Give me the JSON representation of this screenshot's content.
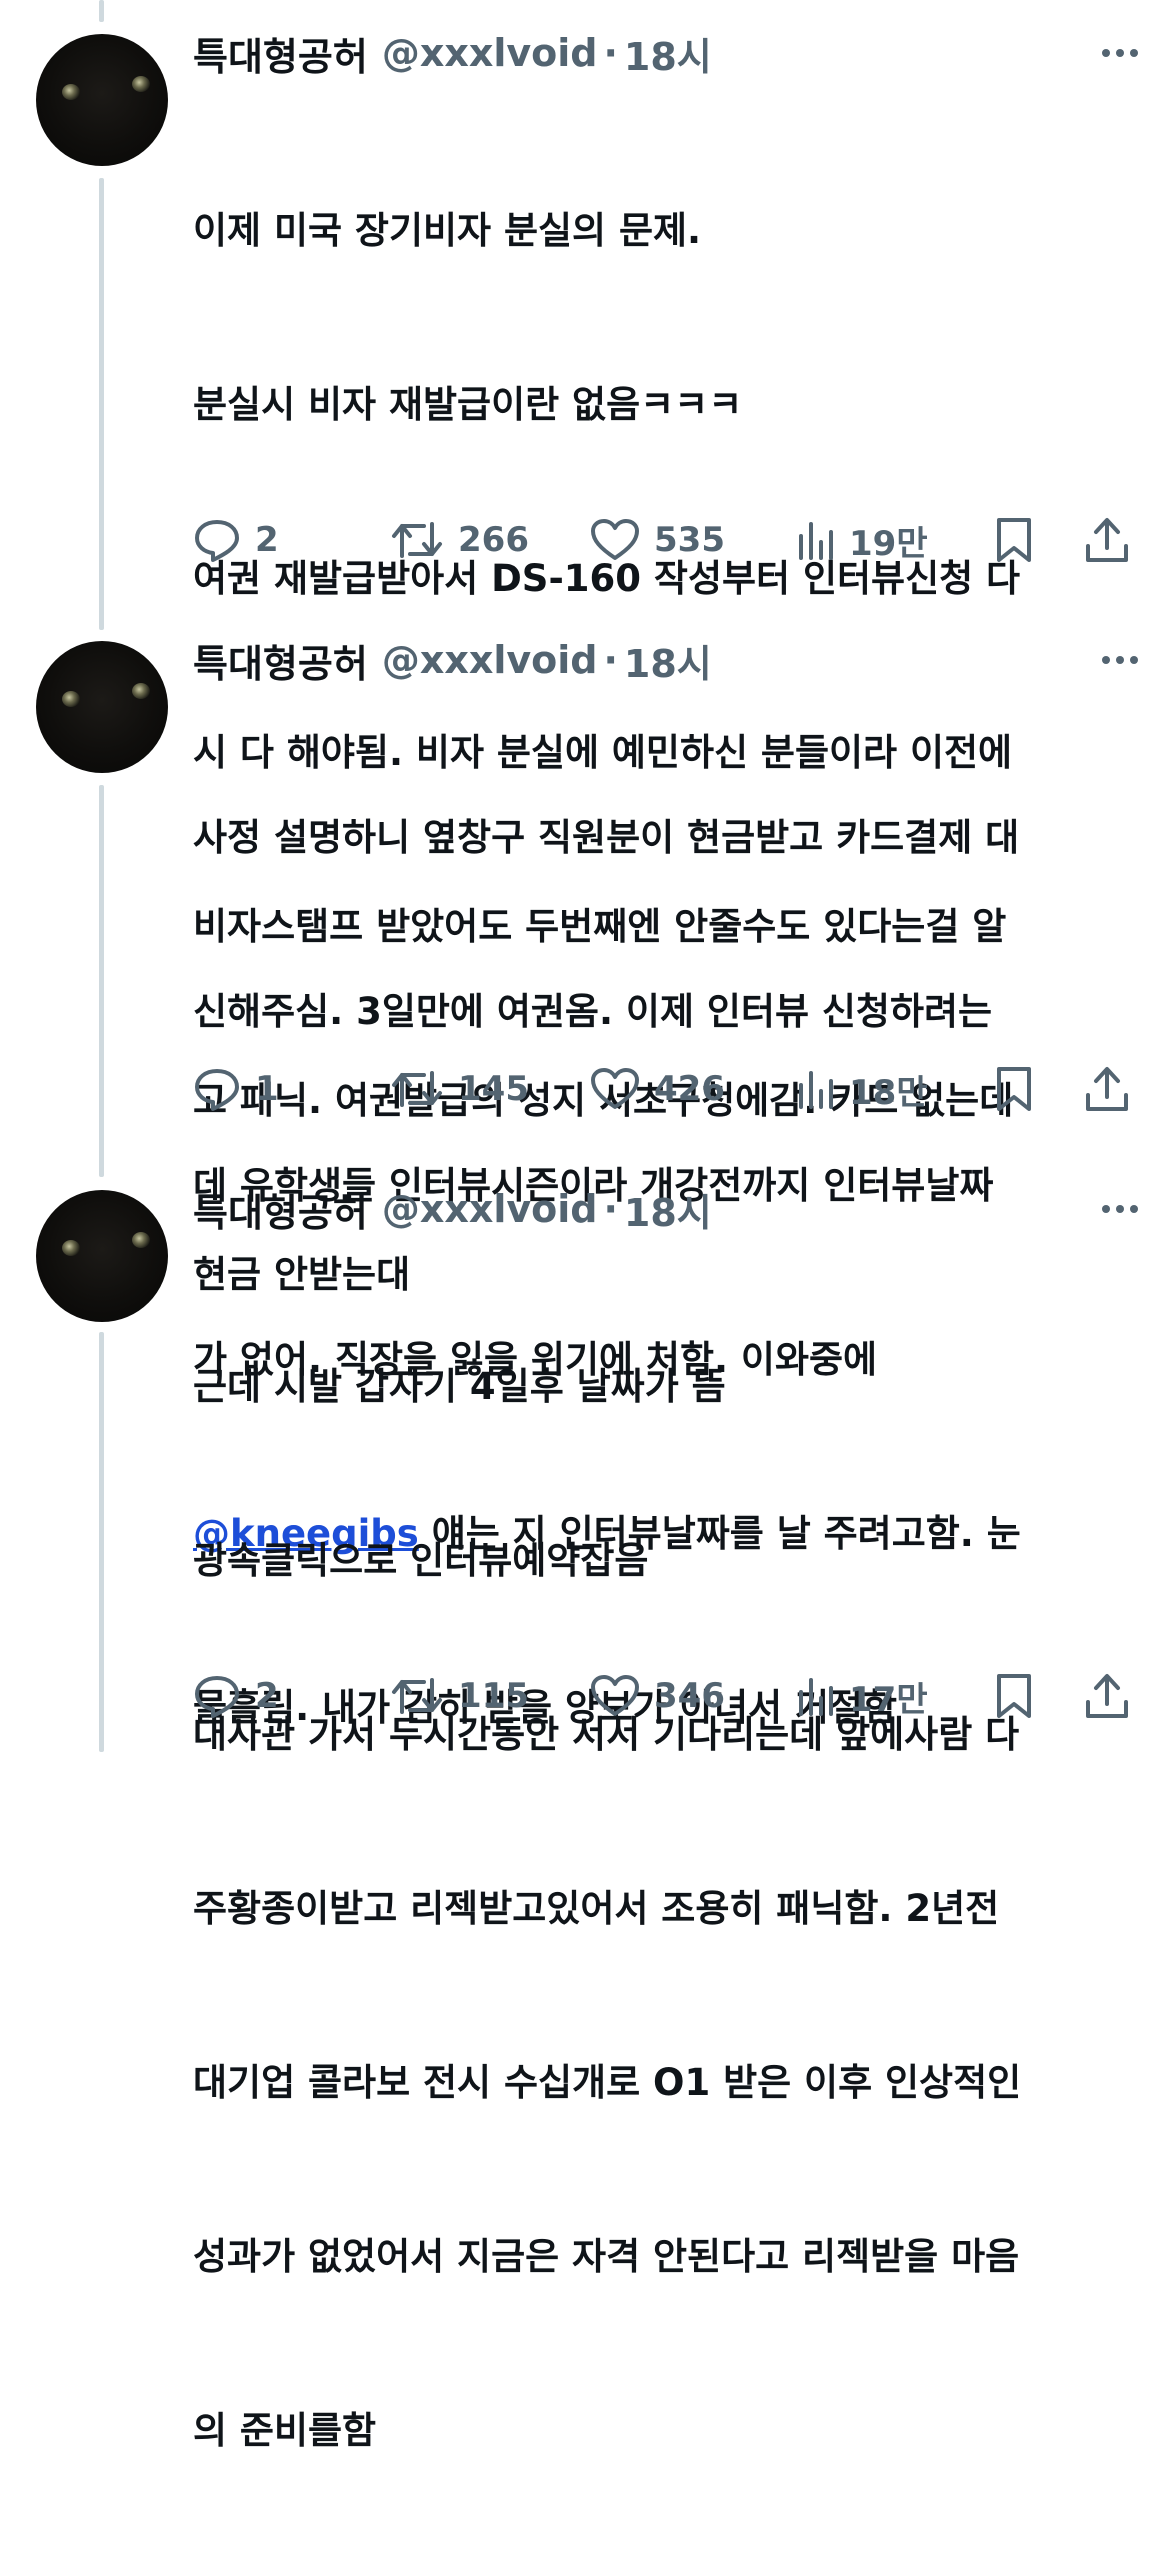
{
  "tweets": [
    {
      "display_name": "특대형공허",
      "handle": "@xxxlvoid",
      "separator": "·",
      "time": "18시",
      "lines": [
        "이제 미국 장기비자 분실의 문제.",
        "분실시 비자 재발급이란 없음ㅋㅋㅋ",
        "여권 재발급받아서 DS-160 작성부터 인터뷰신청 다",
        "시 다 해야됨. 비자 분실에 예민하신 분들이라 이전에",
        "비자스탬프 받았어도 두번째엔 안줄수도 있다는걸 알",
        "고 패닉. 여권발급의 성지 서초구청에감. 카드 없는데",
        "현금 안받는대"
      ],
      "mention": "",
      "replies": "2",
      "retweets": "266",
      "likes": "535",
      "views": "19만"
    },
    {
      "display_name": "특대형공허",
      "handle": "@xxxlvoid",
      "separator": "·",
      "time": "18시",
      "lines_before_mention": [
        "사정 설명하니 옆창구 직원분이 현금받고 카드결제 대",
        "신해주심. 3일만에 여권옴. 이제 인터뷰 신청하려는",
        "데 유학생들 인터뷰시즌이라 개강전까지 인터뷰날짜",
        "가 없어. 직장을 잃을 위기에 처함. 이와중에"
      ],
      "mention": "@kneegibs",
      "mention_suffix": " 얘는 지 인터뷰날짜를 날 주려고함. 눈",
      "lines_after_mention": [
        "물흘림. 내가 감히 받을 양보가 아녀서 거절함"
      ],
      "replies": "1",
      "retweets": "145",
      "likes": "426",
      "views": "18만"
    },
    {
      "display_name": "특대형공허",
      "handle": "@xxxlvoid",
      "separator": "·",
      "time": "18시",
      "lines": [
        "근데 시발 갑자기 4일후 날짜가 뜸",
        "광속클릭으로 인터뷰예약잡음",
        "대사관 가서 두시간동안 서서 기다리는데 앞에사람 다",
        "주황종이받고 리젝받고있어서 조용히 패닉함. 2년전",
        "대기업 콜라보 전시 수십개로 O1 받은 이후 인상적인",
        "성과가 없었어서 지금은 자격 안된다고 리젝받을 마음",
        "의 준비를함"
      ],
      "mention": "",
      "replies": "2",
      "retweets": "115",
      "likes": "346",
      "views": "17만"
    }
  ],
  "icons": {
    "reply": "reply-icon",
    "retweet": "retweet-icon",
    "like": "heart-icon",
    "views": "views-icon",
    "bookmark": "bookmark-icon",
    "share": "share-icon",
    "more": "more-icon"
  },
  "colors": {
    "text": "#0f1419",
    "secondary": "#536471",
    "mention": "#1d4ed8",
    "thread_line": "#cfd9de"
  }
}
